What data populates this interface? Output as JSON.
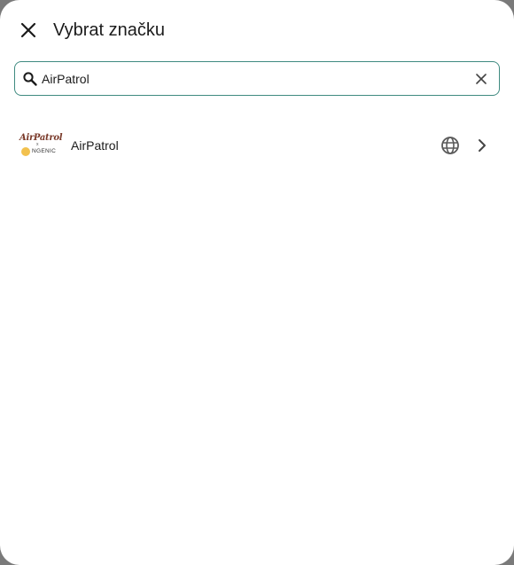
{
  "dialog": {
    "title": "Vybrat značku",
    "close_icon": "close-icon"
  },
  "search": {
    "value": "AirPatrol",
    "icon": "search-icon",
    "clear_icon": "clear-icon",
    "accent_color": "#3f8a80"
  },
  "results": [
    {
      "label": "AirPatrol",
      "logo_top": "AirPatrol",
      "logo_x": "x",
      "logo_bottom": "NGENIC",
      "website_icon": "globe-icon",
      "chevron_icon": "chevron-right-icon"
    }
  ]
}
